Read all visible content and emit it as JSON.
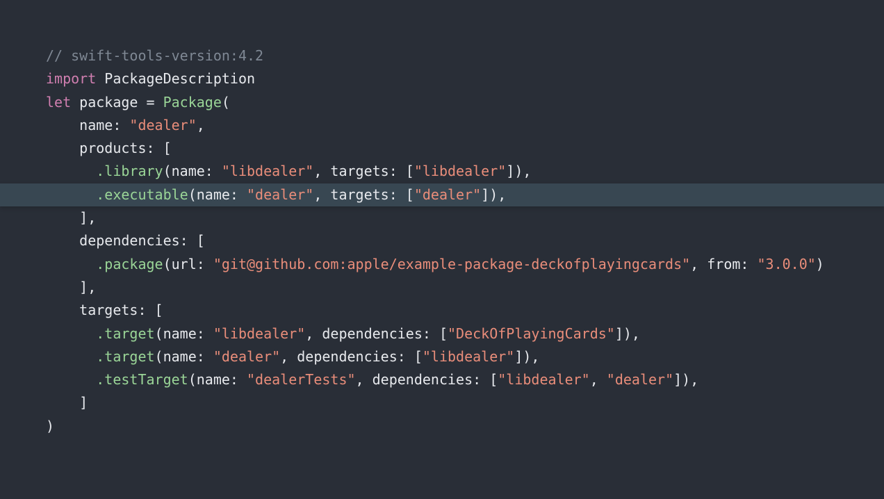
{
  "lines": [
    {
      "highlight": false,
      "tokens": [
        {
          "cls": "c-comment",
          "t": "// swift-tools-version:4.2"
        }
      ]
    },
    {
      "highlight": false,
      "tokens": [
        {
          "cls": "c-keyword",
          "t": "import"
        },
        {
          "cls": "c-default",
          "t": " PackageDescription"
        }
      ]
    },
    {
      "highlight": false,
      "tokens": [
        {
          "cls": "c-default",
          "t": ""
        }
      ]
    },
    {
      "highlight": false,
      "tokens": [
        {
          "cls": "c-keyword",
          "t": "let"
        },
        {
          "cls": "c-default",
          "t": " package = "
        },
        {
          "cls": "c-type",
          "t": "Package"
        },
        {
          "cls": "c-default",
          "t": "("
        }
      ]
    },
    {
      "highlight": false,
      "tokens": [
        {
          "cls": "c-default",
          "t": "    name: "
        },
        {
          "cls": "c-string",
          "t": "\"dealer\""
        },
        {
          "cls": "c-default",
          "t": ","
        }
      ]
    },
    {
      "highlight": false,
      "tokens": [
        {
          "cls": "c-default",
          "t": "    products: ["
        }
      ]
    },
    {
      "highlight": false,
      "tokens": [
        {
          "cls": "c-default",
          "t": "      "
        },
        {
          "cls": "c-type",
          "t": ".library"
        },
        {
          "cls": "c-default",
          "t": "(name: "
        },
        {
          "cls": "c-string",
          "t": "\"libdealer\""
        },
        {
          "cls": "c-default",
          "t": ", targets: ["
        },
        {
          "cls": "c-string",
          "t": "\"libdealer\""
        },
        {
          "cls": "c-default",
          "t": "]),"
        }
      ]
    },
    {
      "highlight": true,
      "tokens": [
        {
          "cls": "c-default",
          "t": "      "
        },
        {
          "cls": "c-type",
          "t": ".executable"
        },
        {
          "cls": "c-default",
          "t": "(name: "
        },
        {
          "cls": "c-string",
          "t": "\"dealer\""
        },
        {
          "cls": "c-default",
          "t": ", targets: ["
        },
        {
          "cls": "c-string",
          "t": "\"dealer\""
        },
        {
          "cls": "c-default",
          "t": "]),"
        }
      ]
    },
    {
      "highlight": false,
      "tokens": [
        {
          "cls": "c-default",
          "t": "    ],"
        }
      ]
    },
    {
      "highlight": false,
      "tokens": [
        {
          "cls": "c-default",
          "t": "    dependencies: ["
        }
      ]
    },
    {
      "highlight": false,
      "tokens": [
        {
          "cls": "c-default",
          "t": "      "
        },
        {
          "cls": "c-type",
          "t": ".package"
        },
        {
          "cls": "c-default",
          "t": "(url: "
        },
        {
          "cls": "c-string",
          "t": "\"git@github.com:apple/example-package-deckofplayingcards\""
        },
        {
          "cls": "c-default",
          "t": ", from: "
        },
        {
          "cls": "c-string",
          "t": "\"3.0.0\""
        },
        {
          "cls": "c-default",
          "t": ")"
        }
      ]
    },
    {
      "highlight": false,
      "tokens": [
        {
          "cls": "c-default",
          "t": "    ],"
        }
      ]
    },
    {
      "highlight": false,
      "tokens": [
        {
          "cls": "c-default",
          "t": "    targets: ["
        }
      ]
    },
    {
      "highlight": false,
      "tokens": [
        {
          "cls": "c-default",
          "t": "      "
        },
        {
          "cls": "c-type",
          "t": ".target"
        },
        {
          "cls": "c-default",
          "t": "(name: "
        },
        {
          "cls": "c-string",
          "t": "\"libdealer\""
        },
        {
          "cls": "c-default",
          "t": ", dependencies: ["
        },
        {
          "cls": "c-string",
          "t": "\"DeckOfPlayingCards\""
        },
        {
          "cls": "c-default",
          "t": "]),"
        }
      ]
    },
    {
      "highlight": false,
      "tokens": [
        {
          "cls": "c-default",
          "t": "      "
        },
        {
          "cls": "c-type",
          "t": ".target"
        },
        {
          "cls": "c-default",
          "t": "(name: "
        },
        {
          "cls": "c-string",
          "t": "\"dealer\""
        },
        {
          "cls": "c-default",
          "t": ", dependencies: ["
        },
        {
          "cls": "c-string",
          "t": "\"libdealer\""
        },
        {
          "cls": "c-default",
          "t": "]),"
        }
      ]
    },
    {
      "highlight": false,
      "tokens": [
        {
          "cls": "c-default",
          "t": "      "
        },
        {
          "cls": "c-type",
          "t": ".testTarget"
        },
        {
          "cls": "c-default",
          "t": "(name: "
        },
        {
          "cls": "c-string",
          "t": "\"dealerTests\""
        },
        {
          "cls": "c-default",
          "t": ", dependencies: ["
        },
        {
          "cls": "c-string",
          "t": "\"libdealer\""
        },
        {
          "cls": "c-default",
          "t": ", "
        },
        {
          "cls": "c-string",
          "t": "\"dealer\""
        },
        {
          "cls": "c-default",
          "t": "]),"
        }
      ]
    },
    {
      "highlight": false,
      "tokens": [
        {
          "cls": "c-default",
          "t": "    ]"
        }
      ]
    },
    {
      "highlight": false,
      "tokens": [
        {
          "cls": "c-default",
          "t": ")"
        }
      ]
    }
  ]
}
